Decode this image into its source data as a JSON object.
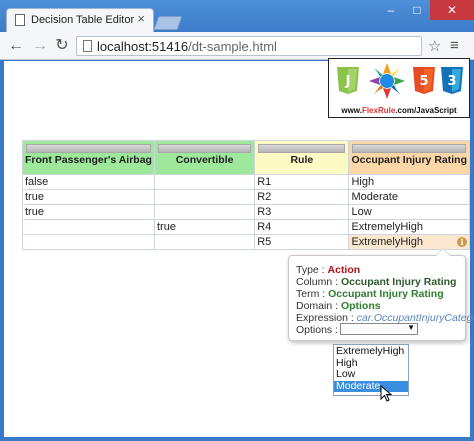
{
  "browser": {
    "tab_title": "Decision Table Editor",
    "tab_close": "×",
    "url_host": "localhost:51416",
    "url_path": "/dt-sample.html",
    "window_controls": {
      "minimize": "‒",
      "maximize": "□",
      "close": "✕"
    },
    "nav_icons": {
      "back": "←",
      "forward": "→",
      "reload": "↻",
      "star": "☆",
      "menu": "≡"
    }
  },
  "logo": {
    "badges": [
      "JS",
      "HTML",
      "CSS"
    ],
    "text_prefix": "www.",
    "text_brand": "FlexRule",
    "text_suffix": ".com/JavaScript"
  },
  "table": {
    "columns": [
      {
        "label": "Front Passenger's Airbag",
        "color": "#9ee89b"
      },
      {
        "label": "Convertible",
        "color": "#9ee89b"
      },
      {
        "label": "Rule",
        "color": "#fdfac4"
      },
      {
        "label": "Occupant Injury Rating",
        "color": "#fbd7a8"
      }
    ],
    "rows": [
      [
        "false",
        "",
        "R1",
        "High"
      ],
      [
        "true",
        "",
        "R2",
        "Moderate"
      ],
      [
        "true",
        "",
        "R3",
        "Low"
      ],
      [
        "",
        "true",
        "R4",
        "ExtremelyHigh"
      ],
      [
        "",
        "",
        "R5",
        "ExtremelyHigh"
      ]
    ],
    "selected_cell_icon": "i"
  },
  "popover": {
    "type_label": "Type : ",
    "type_value": "Action",
    "column_label": "Column : ",
    "column_value": "Occupant Injury Rating",
    "term_label": "Term : ",
    "term_value": "Occupant Injury Rating",
    "domain_label": "Domain : ",
    "domain_value": "Options",
    "expression_label": "Expression : ",
    "expression_value": "car.OccupantInjuryCategory",
    "options_label": "Options : ",
    "options_selected": "",
    "options_list": [
      "ExtremelyHigh",
      "High",
      "Low",
      "Moderate"
    ],
    "highlighted_option": "Moderate"
  }
}
